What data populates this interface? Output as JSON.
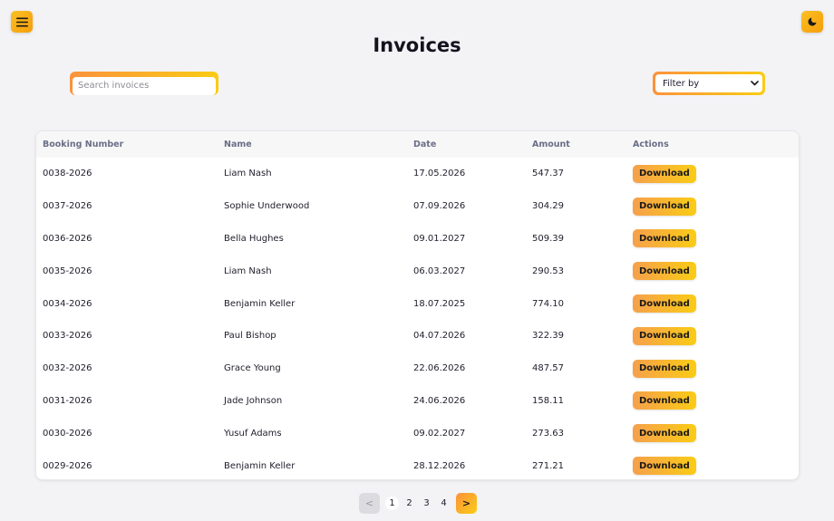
{
  "page": {
    "title": "Invoices"
  },
  "toolbar": {
    "search_placeholder": "Search invoices",
    "filter_label": "Filter by"
  },
  "icons": {
    "menu": "hamburger-icon",
    "theme": "moon-icon",
    "dropdown": "chevron-down-icon"
  },
  "colors": {
    "accent_start": "#fb923c",
    "accent_end": "#facc15",
    "background": "#f3f3f5"
  },
  "table": {
    "headers": [
      "Booking Number",
      "Name",
      "Date",
      "Amount",
      "Actions"
    ],
    "rows": [
      {
        "booking": "0038-2026",
        "name": "Liam Nash",
        "date": "17.05.2026",
        "amount": "547.37",
        "action": "Download"
      },
      {
        "booking": "0037-2026",
        "name": "Sophie Underwood",
        "date": "07.09.2026",
        "amount": "304.29",
        "action": "Download"
      },
      {
        "booking": "0036-2026",
        "name": "Bella Hughes",
        "date": "09.01.2027",
        "amount": "509.39",
        "action": "Download"
      },
      {
        "booking": "0035-2026",
        "name": "Liam Nash",
        "date": "06.03.2027",
        "amount": "290.53",
        "action": "Download"
      },
      {
        "booking": "0034-2026",
        "name": "Benjamin Keller",
        "date": "18.07.2025",
        "amount": "774.10",
        "action": "Download"
      },
      {
        "booking": "0033-2026",
        "name": "Paul Bishop",
        "date": "04.07.2026",
        "amount": "322.39",
        "action": "Download"
      },
      {
        "booking": "0032-2026",
        "name": "Grace Young",
        "date": "22.06.2026",
        "amount": "487.57",
        "action": "Download"
      },
      {
        "booking": "0031-2026",
        "name": "Jade Johnson",
        "date": "24.06.2026",
        "amount": "158.11",
        "action": "Download"
      },
      {
        "booking": "0030-2026",
        "name": "Yusuf Adams",
        "date": "09.02.2027",
        "amount": "273.63",
        "action": "Download"
      },
      {
        "booking": "0029-2026",
        "name": "Benjamin Keller",
        "date": "28.12.2026",
        "amount": "271.21",
        "action": "Download"
      }
    ]
  },
  "pagination": {
    "prev": "<",
    "next": ">",
    "pages": [
      "1",
      "2",
      "3",
      "4"
    ],
    "current": "1"
  }
}
